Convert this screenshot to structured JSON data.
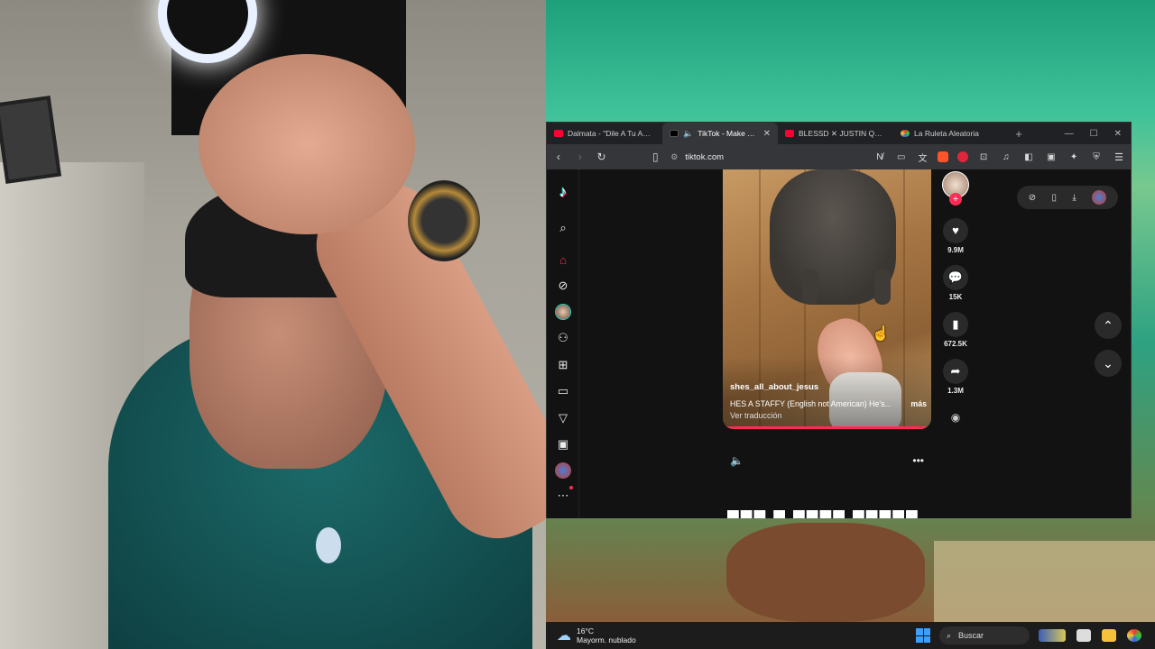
{
  "browser": {
    "tabs": [
      {
        "title": "Dalmata - \"Dile A Tu Amiga\"",
        "favicon": "youtube-icon",
        "active": false
      },
      {
        "title": "TikTok - Make Your Day",
        "favicon": "tiktok-icon",
        "active": true
      },
      {
        "title": "BLESSD ✕ JUSTIN QUILES",
        "favicon": "youtube-icon",
        "active": false
      },
      {
        "title": "La Ruleta Aleatoria",
        "favicon": "roulette-icon",
        "active": false
      }
    ],
    "url": "tiktok.com"
  },
  "video": {
    "author": "shes_all_about_jesus",
    "description": "HES A STAFFY (English not American) He's...",
    "more": "más",
    "translate": "Ver traducción",
    "likes": "9.9M",
    "comments": "15K",
    "saves": "672.5K",
    "shares": "1.3M"
  },
  "taskbar": {
    "temperature": "16°C",
    "weather": "Mayorm. nublado",
    "search_label": "Buscar"
  },
  "colors": {
    "tiktok_accent": "#fe2c55",
    "youtube_red": "#ff0033",
    "page_bg": "#121212"
  }
}
